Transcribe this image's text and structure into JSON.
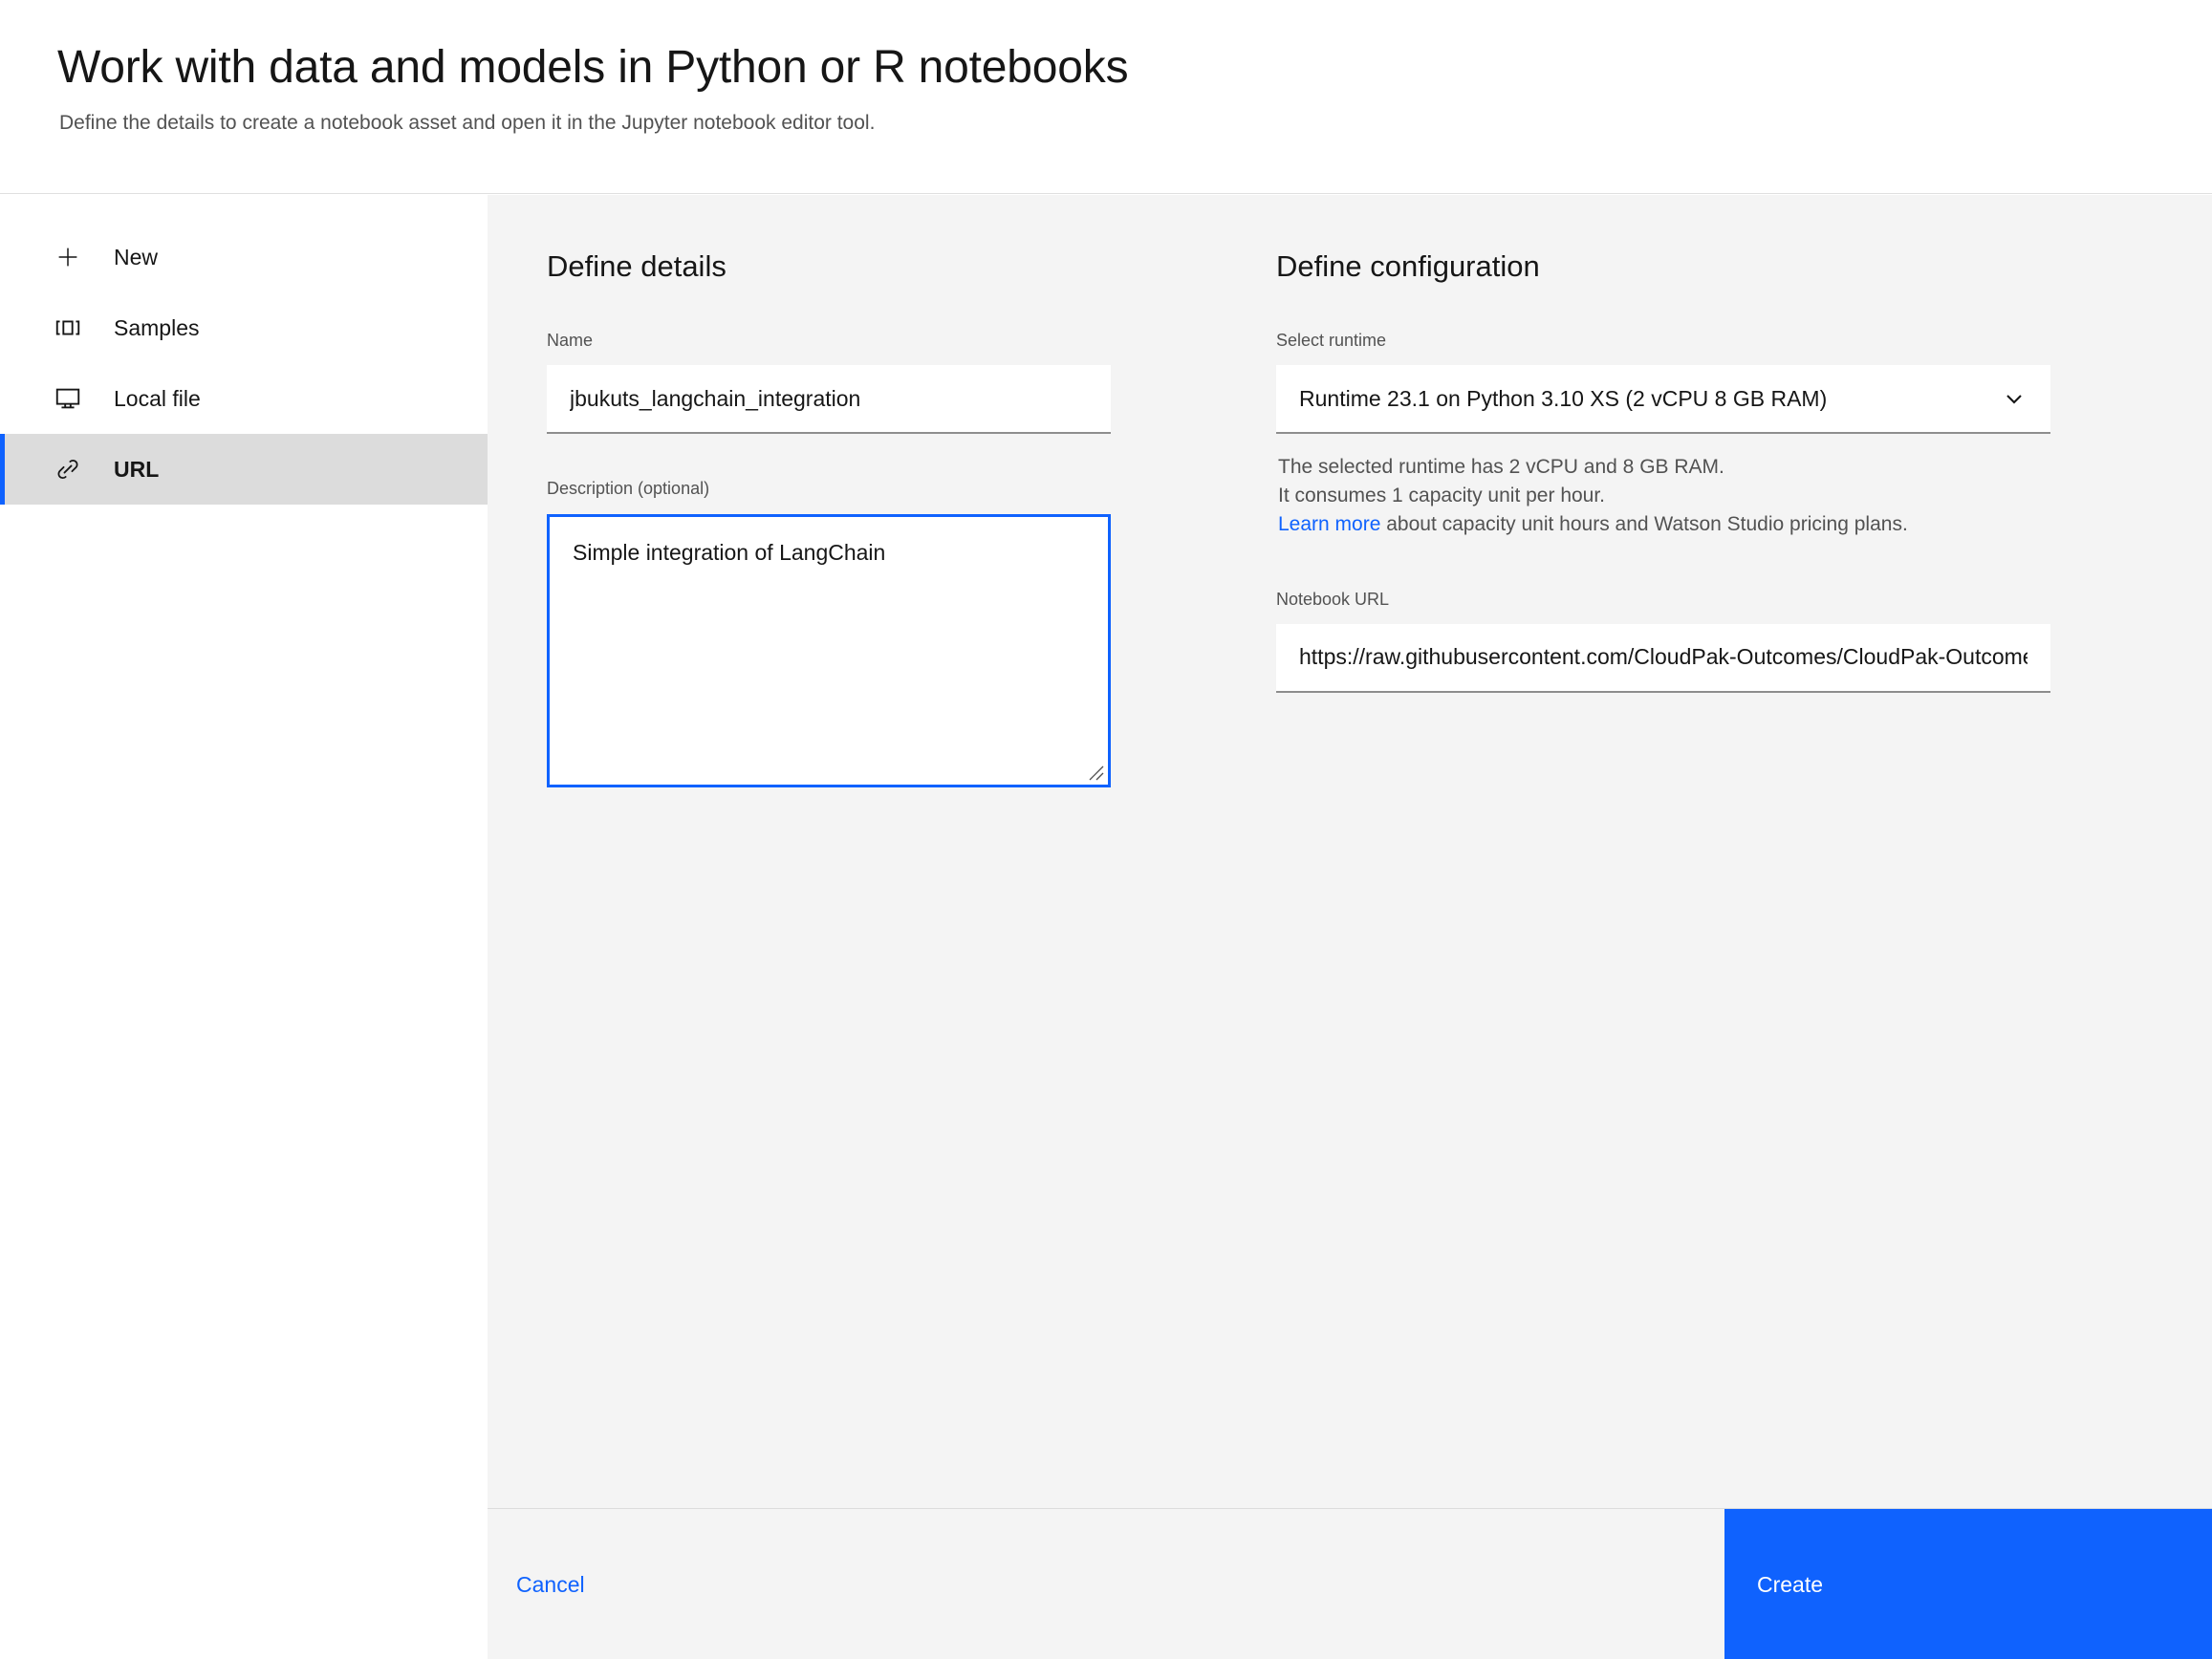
{
  "header": {
    "title": "Work with data and models in Python or R notebooks",
    "subtitle": "Define the details to create a notebook asset and open it in the Jupyter notebook editor tool."
  },
  "sidebar": {
    "items": [
      {
        "label": "New",
        "icon": "plus-icon",
        "selected": false
      },
      {
        "label": "Samples",
        "icon": "carousel-icon",
        "selected": false
      },
      {
        "label": "Local file",
        "icon": "monitor-icon",
        "selected": false
      },
      {
        "label": "URL",
        "icon": "link-icon",
        "selected": true
      }
    ]
  },
  "details": {
    "section_title": "Define details",
    "name_label": "Name",
    "name_value": "jbukuts_langchain_integration",
    "name_placeholder": "",
    "description_label": "Description (optional)",
    "description_value": "Simple integration of LangChain",
    "description_placeholder": ""
  },
  "configuration": {
    "section_title": "Define configuration",
    "runtime_label": "Select runtime",
    "runtime_value": "Runtime 23.1 on Python 3.10 XS (2 vCPU 8 GB RAM)",
    "helper_line1": "The selected runtime has 2 vCPU and 8 GB RAM.",
    "helper_line2": "It consumes 1 capacity unit per hour.",
    "helper_link": "Learn more",
    "helper_line3": " about capacity unit hours and Watson Studio pricing plans.",
    "url_label": "Notebook URL",
    "url_value": "https://raw.githubusercontent.com/CloudPak-Outcomes/CloudPak-Outcomes",
    "url_placeholder": ""
  },
  "footer": {
    "cancel_label": "Cancel",
    "create_label": "Create"
  },
  "colors": {
    "accent": "#0f62fe",
    "content_bg": "#f4f4f4",
    "selected_nav_bg": "#dcdcdc",
    "text_primary": "#161616",
    "text_secondary": "#525252"
  }
}
